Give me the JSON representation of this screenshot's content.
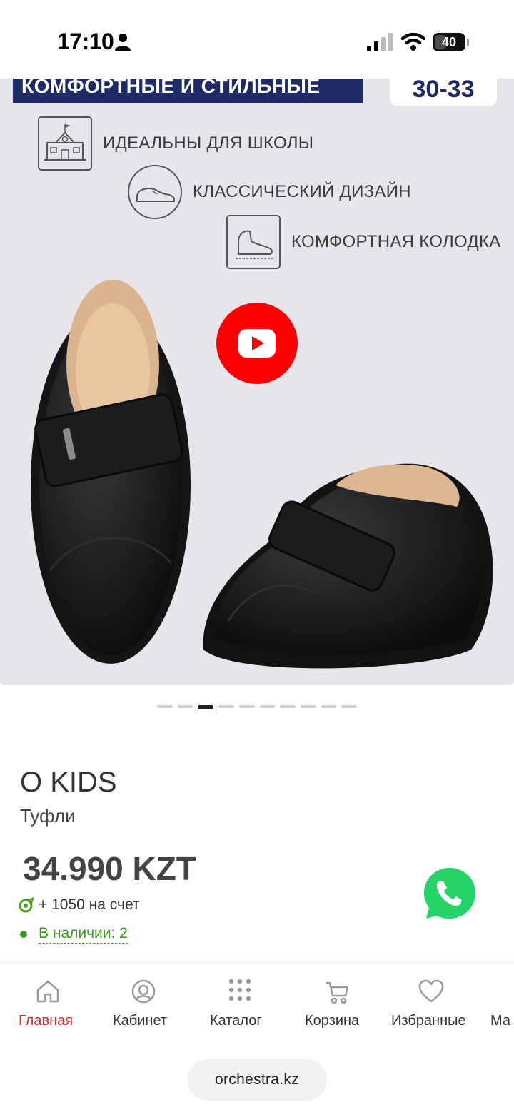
{
  "status_bar": {
    "time": "17:10",
    "battery": "40"
  },
  "product_image": {
    "banner_text": "КОМФОРТНЫЕ И СТИЛЬНЫЕ",
    "size_range": "30-33",
    "features": [
      {
        "icon": "school-icon",
        "label": "ИДЕАЛЬНЫ ДЛЯ ШКОЛЫ"
      },
      {
        "icon": "shoe-icon",
        "label": "КЛАССИЧЕСКИЙ ДИЗАЙН"
      },
      {
        "icon": "shoe-last-icon",
        "label": "КОМФОРТНАЯ КОЛОДКА"
      }
    ],
    "pager": {
      "count": 10,
      "active_index": 2
    }
  },
  "product": {
    "brand": "O KIDS",
    "type": "Туфли",
    "price": "34.990 KZT",
    "bonus": "+ 1050 на счет",
    "stock": "В наличии: 2"
  },
  "nav": {
    "items": [
      {
        "label": "Главная",
        "icon": "home-icon",
        "active": true
      },
      {
        "label": "Кабинет",
        "icon": "user-circle-icon",
        "active": false
      },
      {
        "label": "Каталог",
        "icon": "grid-dots-icon",
        "active": false
      },
      {
        "label": "Корзина",
        "icon": "cart-icon",
        "active": false
      },
      {
        "label": "Избранные",
        "icon": "heart-icon",
        "active": false
      },
      {
        "label": "Ма",
        "icon": "",
        "active": false
      }
    ]
  },
  "browser": {
    "url": "orchestra.kz"
  },
  "colors": {
    "accent": "#e0262d",
    "in_stock": "#3a9a20",
    "banner": "#1f2b66",
    "whatsapp": "#25d366"
  }
}
